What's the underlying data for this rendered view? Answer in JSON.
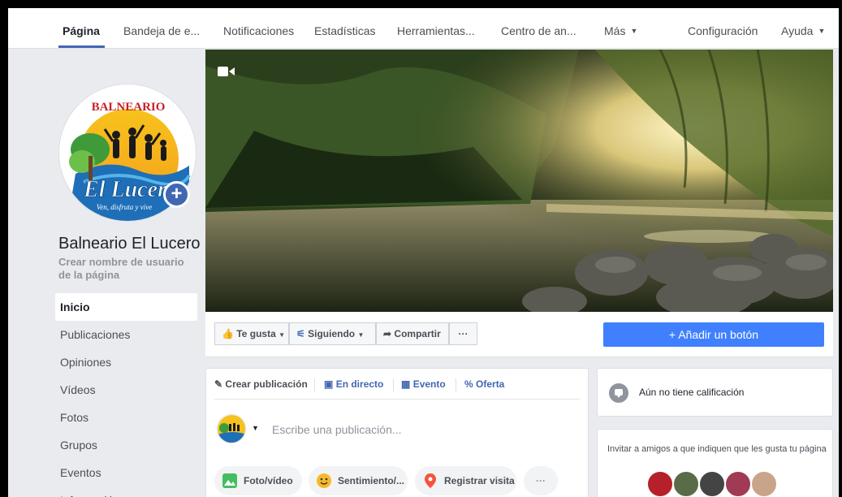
{
  "nav": {
    "items": [
      "Página",
      "Bandeja de e...",
      "Notificaciones",
      "Estadísticas",
      "Herramientas...",
      "Centro de an...",
      "Más",
      "Configuración",
      "Ayuda"
    ],
    "active": "Página"
  },
  "page": {
    "name": "Balneario El Lucero",
    "username_prompt": "Crear nombre de usuario de la página",
    "logo": {
      "top_text": "BALNEARIO",
      "main_text": "El Lucero",
      "tagline": "Ven, disfruta y vive"
    }
  },
  "sidebar": {
    "items": [
      "Inicio",
      "Publicaciones",
      "Opiniones",
      "Vídeos",
      "Fotos",
      "Grupos",
      "Eventos",
      "Información"
    ]
  },
  "actions": {
    "like": "Te gusta",
    "following": "Siguiendo",
    "share": "Compartir",
    "more": "···",
    "add_button": "+ Añadir un botón"
  },
  "composer": {
    "tabs": [
      "Crear publicación",
      "En directo",
      "Evento",
      "Oferta"
    ],
    "placeholder": "Escribe una publicación...",
    "chips": [
      "Foto/vídeo",
      "Sentimiento/...",
      "Registrar visita",
      "···"
    ]
  },
  "right": {
    "rating": "Aún no tiene calificación",
    "invite": "Invitar a amigos a que indiquen que les gusta tu página"
  },
  "colors": {
    "accent": "#4267b2",
    "button_blue": "#4080ff",
    "background": "#e9ebee"
  }
}
